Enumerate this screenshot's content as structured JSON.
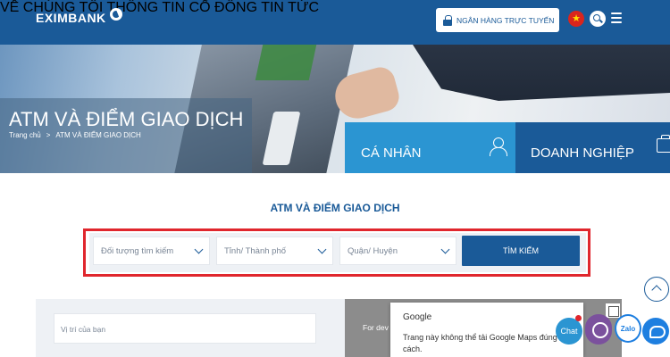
{
  "brand": {
    "logo_text": "EXIMBANK",
    "primary_color": "#1a5a98",
    "accent_color": "#2b95d2",
    "highlight_color": "#e0262d"
  },
  "header": {
    "nav": [
      "VỀ CHÚNG TÔI",
      "THÔNG TIN CỔ ĐÔNG",
      "TIN TỨC"
    ],
    "online_banking_label": "NGÂN HÀNG TRỰC TUYẾN",
    "language_flag_icon": "vietnam-flag-icon",
    "search_icon": "search-icon",
    "menu_icon": "hamburger-menu-icon"
  },
  "hero": {
    "title": "ATM VÀ ĐIỂM GIAO DỊCH",
    "breadcrumb": {
      "home": "Trang chủ",
      "separator": ">",
      "current": "ATM VÀ ĐIỂM GIAO DỊCH"
    },
    "tabs": [
      {
        "label": "CÁ NHÂN",
        "icon": "person-icon"
      },
      {
        "label": "DOANH NGHIỆP",
        "icon": "briefcase-icon"
      }
    ]
  },
  "search": {
    "section_title": "ATM VÀ ĐIỂM GIAO DỊCH",
    "selects": [
      {
        "placeholder": "Đối tượng tìm kiếm"
      },
      {
        "placeholder": "Tỉnh/ Thành phố"
      },
      {
        "placeholder": "Quận/ Huyện"
      }
    ],
    "button_label": "TÌM KIẾM"
  },
  "map": {
    "location_placeholder": "Vị trí của bạn",
    "background_text": "For dev",
    "google_dialog": {
      "title": "Google",
      "message": "Trang này không thể tải Google Maps đúng cách."
    }
  },
  "widgets": {
    "chat_label": "Chat",
    "zalo_label": "Zalo"
  }
}
